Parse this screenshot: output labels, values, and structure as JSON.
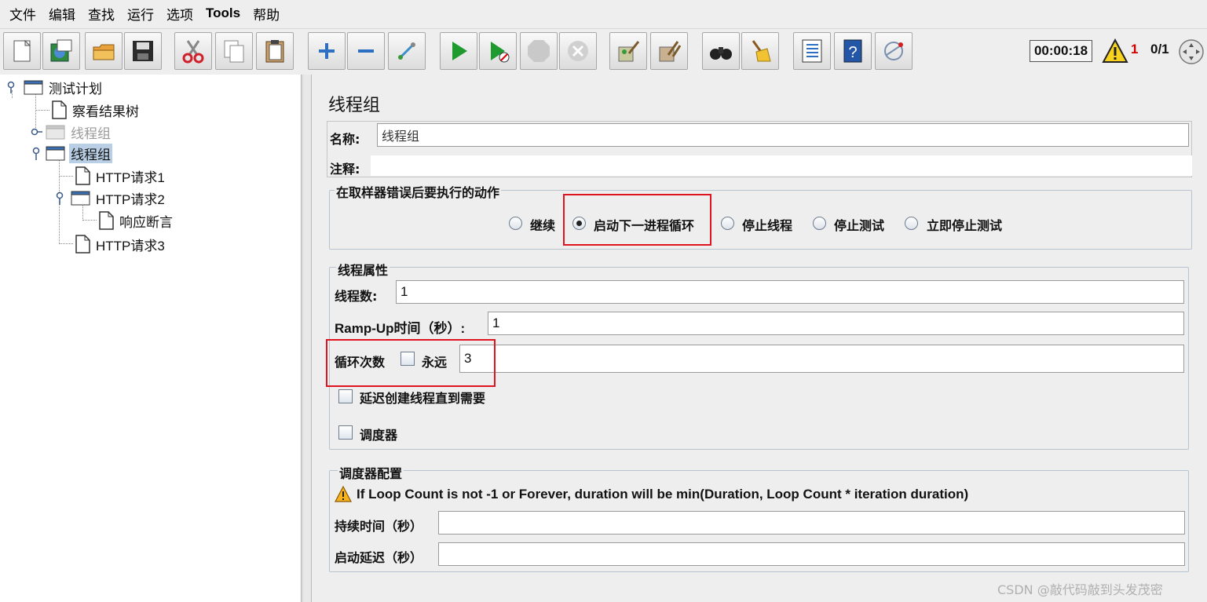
{
  "menu": [
    "文件",
    "编辑",
    "查找",
    "运行",
    "选项",
    "Tools",
    "帮助"
  ],
  "toolbar": {
    "buttons": [
      "new-icon",
      "templates-icon",
      "open-icon",
      "save-icon",
      "cut-icon",
      "copy-icon",
      "paste-icon",
      "expand-icon",
      "collapse-icon",
      "toggle-icon",
      "start-icon",
      "start-no-pause-icon",
      "stop-icon",
      "shutdown-icon",
      "clear-icon",
      "clear-all-icon",
      "search-icon",
      "reset-search-icon",
      "function-helper-icon",
      "help-icon",
      "remote-icon"
    ],
    "timer": "00:00:18",
    "warning_count": "1",
    "threads": "0/1"
  },
  "tree": {
    "nodes": [
      {
        "label": "测试计划"
      },
      {
        "label": "察看结果树"
      },
      {
        "label": "线程组"
      },
      {
        "label": "线程组"
      },
      {
        "label": "HTTP请求1"
      },
      {
        "label": "HTTP请求2"
      },
      {
        "label": "响应断言"
      },
      {
        "label": "HTTP请求3"
      }
    ]
  },
  "main": {
    "title": "线程组",
    "name_label": "名称:",
    "name_value": "线程组",
    "comment_label": "注释:",
    "comment_value": "",
    "on_error": {
      "legend": "在取样器错误后要执行的动作",
      "options": [
        "继续",
        "启动下一进程循环",
        "停止线程",
        "停止测试",
        "立即停止测试"
      ],
      "selected": "启动下一进程循环"
    },
    "thread_props": {
      "legend": "线程属性",
      "threads_label": "线程数:",
      "threads_value": "1",
      "rampup_label": "Ramp-Up时间（秒）:",
      "rampup_value": "1",
      "loop_label": "循环次数",
      "forever_label": "永远",
      "forever_checked": false,
      "loop_value": "3",
      "delay_label": "延迟创建线程直到需要",
      "delay_checked": false,
      "scheduler_label": "调度器",
      "scheduler_checked": false
    },
    "scheduler_config": {
      "legend": "调度器配置",
      "warning": "If Loop Count is not -1 or Forever, duration will be min(Duration, Loop Count * iteration duration)",
      "duration_label": "持续时间（秒）",
      "duration_value": "",
      "delay_label": "启动延迟（秒）",
      "delay_value": ""
    }
  },
  "watermark": "CSDN @敲代码敲到头发茂密",
  "colors": {
    "highlight_box": "#e0141e",
    "selected_node": "#b8cfe5",
    "warning_count": "#d00000"
  }
}
